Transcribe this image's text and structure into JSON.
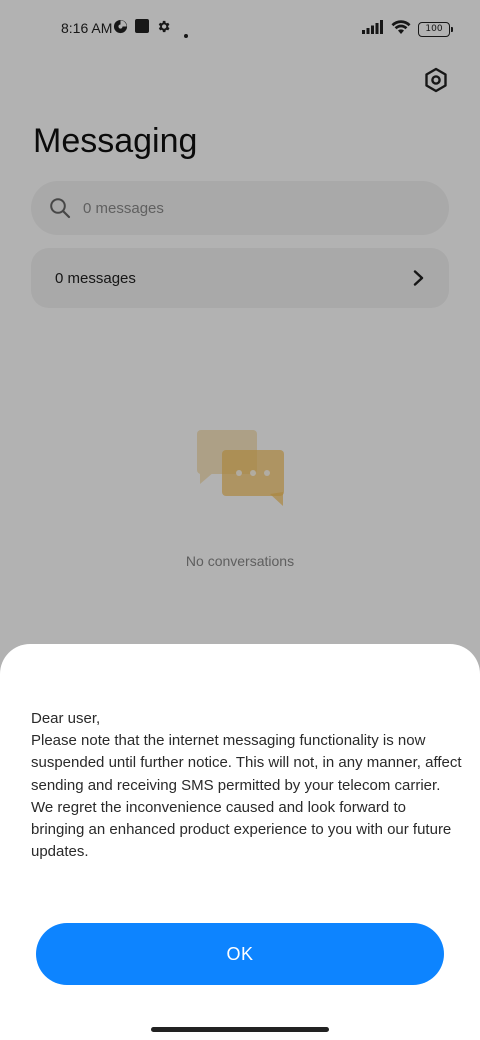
{
  "status_bar": {
    "time": "8:16 AM",
    "battery": "100",
    "icons": [
      "data-saver-icon",
      "square-notification-icon",
      "gear-notification-icon",
      "dot-icon",
      "signal-icon",
      "wifi-icon",
      "battery-icon"
    ]
  },
  "header": {
    "title": "Messaging",
    "settings_icon": "hexagon-settings-icon"
  },
  "search": {
    "placeholder": "0 messages",
    "icon": "search-icon"
  },
  "messages_row": {
    "label": "0 messages",
    "icon": "chevron-right-icon"
  },
  "empty_state": {
    "text": "No conversations",
    "icon": "chat-bubbles-icon",
    "accent_color": "#f6c25c"
  },
  "dialog": {
    "greeting": "Dear user,",
    "body": "Please note that the internet messaging functionality is now suspended until further notice. This will not, in any manner, affect sending and receiving SMS permitted by your telecom carrier. We regret the inconvenience caused and look forward to bringing an enhanced product experience to you with our future updates.",
    "ok_label": "OK",
    "ok_color": "#0d84ff"
  }
}
